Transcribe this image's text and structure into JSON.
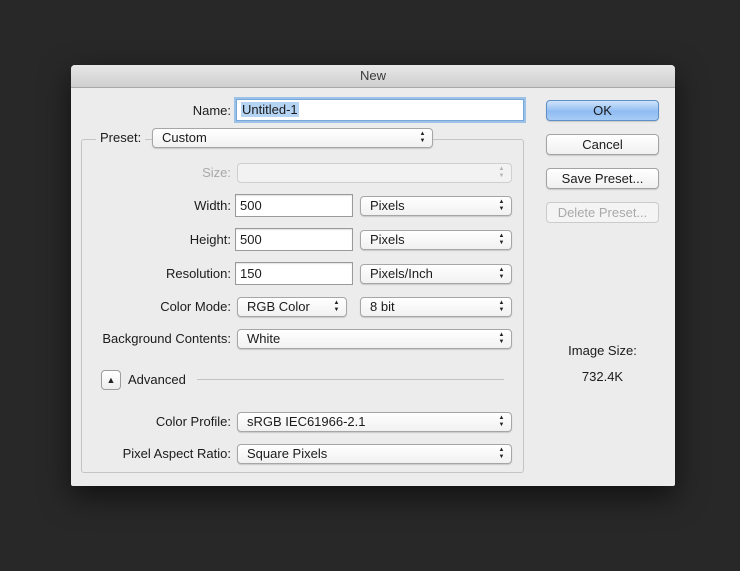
{
  "dialog": {
    "title": "New"
  },
  "name": {
    "label": "Name:",
    "value": "Untitled-1"
  },
  "preset": {
    "label": "Preset:",
    "value": "Custom"
  },
  "size": {
    "label": "Size:",
    "value": ""
  },
  "width": {
    "label": "Width:",
    "value": "500",
    "unit": "Pixels"
  },
  "height": {
    "label": "Height:",
    "value": "500",
    "unit": "Pixels"
  },
  "resolution": {
    "label": "Resolution:",
    "value": "150",
    "unit": "Pixels/Inch"
  },
  "color_mode": {
    "label": "Color Mode:",
    "mode": "RGB Color",
    "depth": "8 bit"
  },
  "background": {
    "label": "Background Contents:",
    "value": "White"
  },
  "advanced": {
    "label": "Advanced"
  },
  "color_profile": {
    "label": "Color Profile:",
    "value": "sRGB IEC61966-2.1"
  },
  "pixel_aspect": {
    "label": "Pixel Aspect Ratio:",
    "value": "Square Pixels"
  },
  "buttons": {
    "ok": "OK",
    "cancel": "Cancel",
    "save_preset": "Save Preset...",
    "delete_preset": "Delete Preset..."
  },
  "image_size": {
    "label": "Image Size:",
    "value": "732.4K"
  },
  "icons": {
    "popup_arrows": "up-down-arrows-icon",
    "disclosure": "triangle-up-icon"
  }
}
